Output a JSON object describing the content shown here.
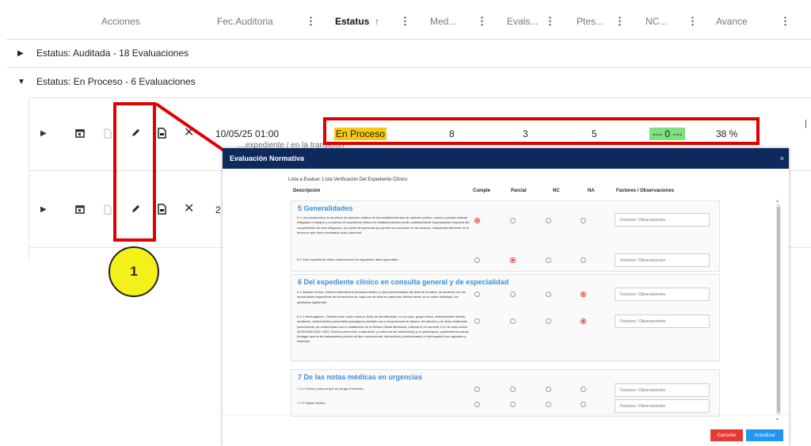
{
  "table": {
    "headers": {
      "acciones": "Acciones",
      "fec_auditoria": "Fec.Auditoria",
      "estatus": "Estatus",
      "sort_icon": "↑",
      "mediciones": "Med...",
      "evaluaciones": "Evals...",
      "pendientes": "Ptes...",
      "nc": "NC...",
      "avance": "Avance",
      "menu_icon": "⋮"
    },
    "groups": [
      {
        "label": "Estatus: Auditada - 18 Evaluaciones",
        "expanded": false
      },
      {
        "label": "Estatus: En Proceso - 6 Evaluaciones",
        "expanded": true
      }
    ],
    "row1": {
      "fecha": "10/05/25 01:00",
      "estatus": "En Proceso",
      "med": "8",
      "evals": "3",
      "ptes": "5",
      "nc": "--- 0 ---",
      "avance": "38 %"
    },
    "row2": {
      "fecha_prefix": "2"
    },
    "partial_text": "…expediente / en la transición"
  },
  "annotation": {
    "step_number": "1",
    "color": "#e00000",
    "badge_color": "#f4f01a"
  },
  "modal": {
    "title": "Evaluación Normativa",
    "close": "×",
    "list_title": "Lista a Evaluar: Lista Verificación Del Expediente Clínico",
    "columns": [
      "Descripcion",
      "Cumple",
      "Parcial",
      "NC",
      "NA",
      "Factores / Observaciones"
    ],
    "obs_placeholder": "Factores / Observaciones",
    "sections": [
      {
        "title": "5 Generalidades",
        "questions": [
          {
            "text": "5.1 Los prestadores de servicios de atención médica de los establecimientos de carácter público, social y privado estarán obligados a integrar y conservar el expediente clínico los establecimientos serán solidariamente responsables respecto del cumplimiento de esta obligación, por parte del personal que preste sus servicios en los mismos, independientemente de la forma en que fuere contratado dicho personal.",
            "selected": 0
          },
          {
            "text": "5.2 Todo expediente clínico deberá tener los siguientes datos generales:",
            "selected": 1
          }
        ]
      },
      {
        "title": "6 Del expediente clínico en consulta general y de especialidad",
        "questions": [
          {
            "text": "6.1 Historia Clínica. Deberá elaborarla el personal médico y otros profesionales del área de la salud, de acuerdo con las necesidades específicas de información de cada uno de ellos en particular, deberá tener, en el orden señalado, los apartados siguientes:",
            "selected": 3
          },
          {
            "text": "6.1.1 Interrogatorio.- Deberá tener como mínimo: ficha de identificación, en su caso, grupo étnico, antecedentes heredo-familiares, antecedentes personales patológicos (incluido uso y dependencia de tabaco, del alcohol y de otras sustancias psicoactivas, de conformidad con lo establecido en la Norma Oficial Mexicana, referida en el numeral 3.12 de esta norma (NOM-028-SSA2-2009, Para la prevención, tratamiento y control de las adicciones)) y no patológicos, padecimiento actual (indagar acerca de tratamientos previos de tipo convencional, alternativos y tradicionales) e interrogatorio por aparatos y sistemas.",
            "selected": 3
          }
        ]
      },
      {
        "title": "7 De las notas médicas en urgencias",
        "questions": [
          {
            "text": "7.1.1 Fecha y hora en que se otorga el servicio;",
            "selected": -1
          },
          {
            "text": "7.1.2 Signos vitales;",
            "selected": -1
          }
        ]
      }
    ],
    "buttons": {
      "cancel": "Cancelar",
      "update": "Actualizar"
    },
    "colors": {
      "header": "#0e2a5c",
      "section_title": "#3b8fd6",
      "cancel": "#e53935",
      "update": "#2196f3"
    }
  }
}
